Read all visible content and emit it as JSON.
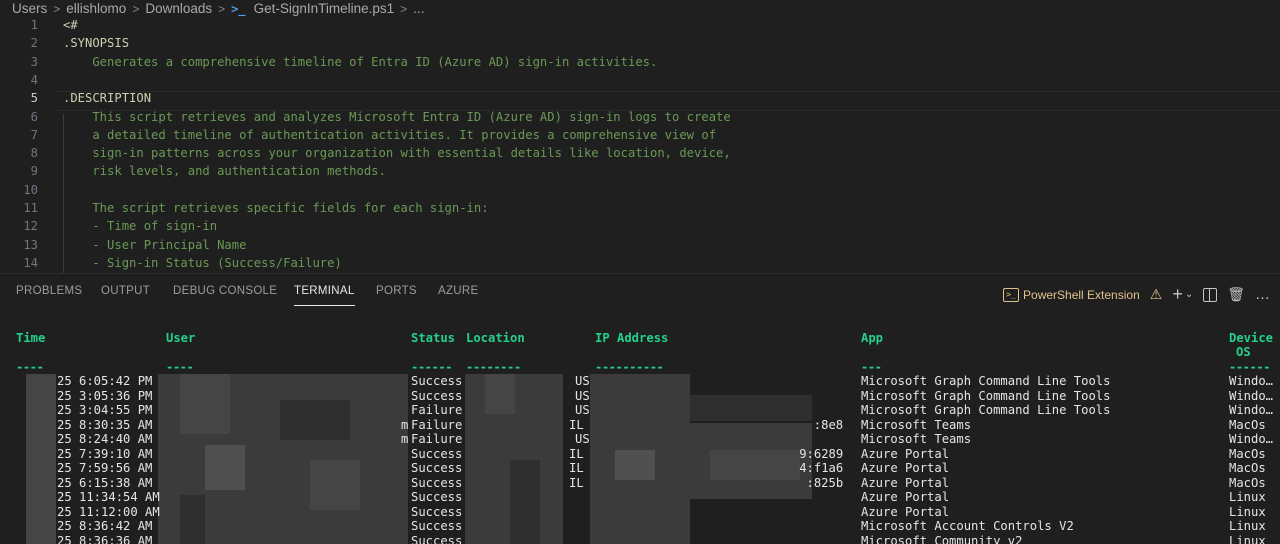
{
  "breadcrumb": {
    "items": [
      "Users",
      "ellishlomo",
      "Downloads"
    ],
    "file": "Get-SignInTimeline.ps1",
    "tail": "..."
  },
  "editor": {
    "active_line": 5,
    "lines": [
      {
        "n": "1",
        "text": "<#"
      },
      {
        "n": "2",
        "text": ".SYNOPSIS"
      },
      {
        "n": "3",
        "text": "    Generates a comprehensive timeline of Entra ID (Azure AD) sign-in activities."
      },
      {
        "n": "4",
        "text": ""
      },
      {
        "n": "5",
        "text": ".DESCRIPTION"
      },
      {
        "n": "6",
        "text": "    This script retrieves and analyzes Microsoft Entra ID (Azure AD) sign-in logs to create"
      },
      {
        "n": "7",
        "text": "    a detailed timeline of authentication activities. It provides a comprehensive view of"
      },
      {
        "n": "8",
        "text": "    sign-in patterns across your organization with essential details like location, device,"
      },
      {
        "n": "9",
        "text": "    risk levels, and authentication methods."
      },
      {
        "n": "10",
        "text": ""
      },
      {
        "n": "11",
        "text": "    The script retrieves specific fields for each sign-in:"
      },
      {
        "n": "12",
        "text": "    - Time of sign-in"
      },
      {
        "n": "13",
        "text": "    - User Principal Name"
      },
      {
        "n": "14",
        "text": "    - Sign-in Status (Success/Failure)"
      }
    ]
  },
  "panel": {
    "tabs": [
      "PROBLEMS",
      "OUTPUT",
      "DEBUG CONSOLE",
      "TERMINAL",
      "PORTS",
      "AZURE"
    ],
    "active_tab": "TERMINAL",
    "extension_label": "PowerShell Extension",
    "icons": [
      "powershell-icon",
      "warning-icon",
      "add-terminal-icon",
      "chevron-down-icon",
      "split-terminal-icon",
      "trash-icon",
      "more-icon"
    ],
    "accent_color": "#e2c08d"
  },
  "terminal": {
    "header_color": "#23d18b",
    "headers": {
      "time": "Time",
      "user": "User",
      "status": "Status",
      "location": "Location",
      "ip": "IP Address",
      "app": "App",
      "device_os_1": "Device",
      "device_os_2": "OS"
    },
    "underlines": {
      "time": "----",
      "user": "----",
      "status": "------",
      "location": "--------",
      "ip": "----------",
      "app": "---",
      "device_os": "------"
    },
    "rows": [
      {
        "time": "25 6:05:42 PM",
        "user_tail": "",
        "status": "Success",
        "loc": "US",
        "ip_tail": "",
        "app": "Microsoft Graph Command Line Tools",
        "os": "Windo…"
      },
      {
        "time": "25 3:05:36 PM",
        "user_tail": "",
        "status": "Success",
        "loc": "US",
        "ip_tail": "",
        "app": "Microsoft Graph Command Line Tools",
        "os": "Windo…"
      },
      {
        "time": "25 3:04:55 PM",
        "user_tail": "",
        "status": "Failure",
        "loc": "US",
        "ip_tail": "",
        "app": "Microsoft Graph Command Line Tools",
        "os": "Windo…"
      },
      {
        "time": "25 8:30:35 AM",
        "user_tail": "m",
        "status": "Failure",
        "loc": "IL",
        "ip_tail": ":8e8",
        "app": "Microsoft Teams",
        "os": "MacOs"
      },
      {
        "time": "25 8:24:40 AM",
        "user_tail": "m",
        "status": "Failure",
        "loc": "US",
        "ip_tail": "",
        "app": "Microsoft Teams",
        "os": "Windo…"
      },
      {
        "time": "25 7:39:10 AM",
        "user_tail": "",
        "status": "Success",
        "loc": "IL",
        "ip_tail": "9:6289",
        "app": "Azure Portal",
        "os": "MacOs"
      },
      {
        "time": "25 7:59:56 AM",
        "user_tail": "",
        "status": "Success",
        "loc": "IL",
        "ip_tail": "4:f1a6",
        "app": "Azure Portal",
        "os": "MacOs"
      },
      {
        "time": "25 6:15:38 AM",
        "user_tail": "",
        "status": "Success",
        "loc": "IL",
        "ip_tail": ":825b",
        "app": "Azure Portal",
        "os": "MacOs"
      },
      {
        "time": "25 11:34:54 AM",
        "user_tail": "",
        "status": "Success",
        "loc": "",
        "ip_tail": "",
        "app": "Azure Portal",
        "os": "Linux"
      },
      {
        "time": "25 11:12:00 AM",
        "user_tail": "",
        "status": "Success",
        "loc": "",
        "ip_tail": "",
        "app": "Azure Portal",
        "os": "Linux"
      },
      {
        "time": "25 8:36:42 AM",
        "user_tail": "",
        "status": "Success",
        "loc": "",
        "ip_tail": "",
        "app": "Microsoft Account Controls V2",
        "os": "Linux"
      },
      {
        "time": "25 8:36:36 AM",
        "user_tail": "",
        "status": "Success",
        "loc": "",
        "ip_tail": "",
        "app": "Microsoft Community v2",
        "os": "Linux"
      }
    ]
  }
}
